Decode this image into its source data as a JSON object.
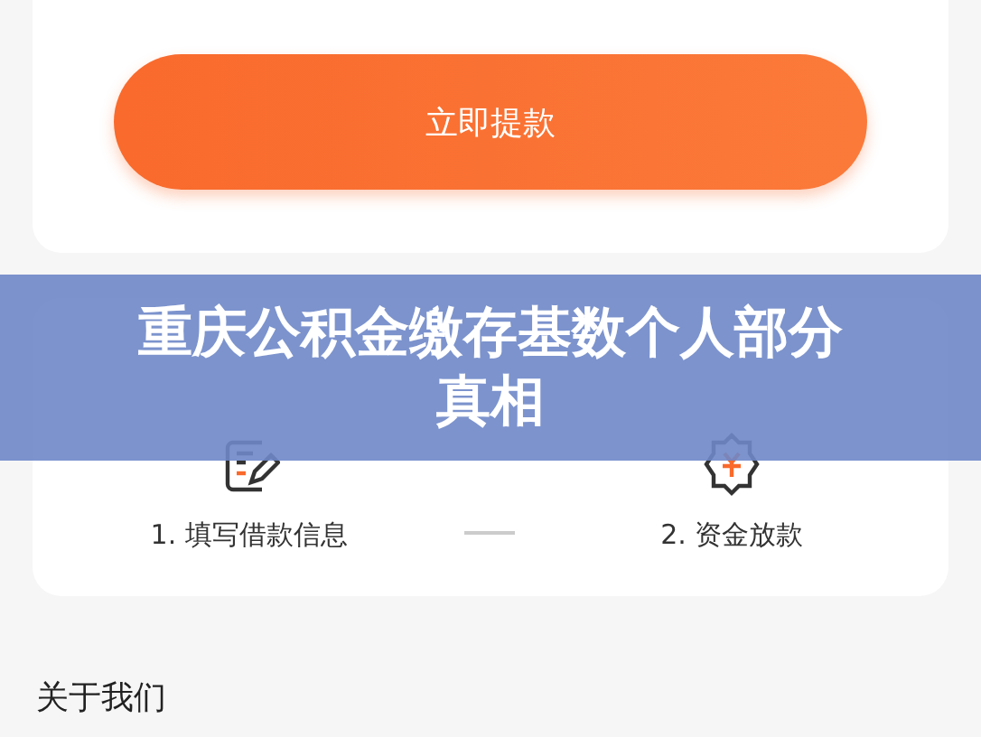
{
  "withdraw_button": {
    "label": "立即提款"
  },
  "process_card": {
    "steps": [
      {
        "label": "1. 填写借款信息",
        "kind": "form"
      },
      {
        "label": "2. 资金放款",
        "kind": "money"
      }
    ]
  },
  "about": {
    "heading": "关于我们"
  },
  "overlay_title": {
    "lines": [
      "重庆公积金缴存基数个人部分",
      "真相"
    ]
  }
}
